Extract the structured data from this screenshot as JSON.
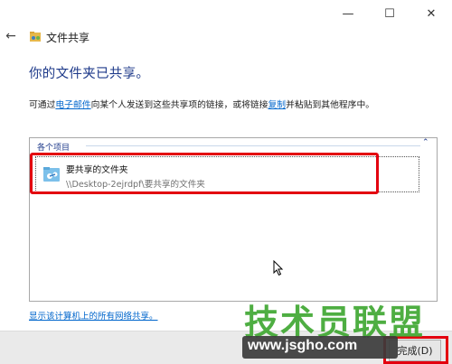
{
  "window": {
    "title": "文件共享",
    "minimize_glyph": "—",
    "maximize_glyph": "☐",
    "close_glyph": "✕"
  },
  "nav": {
    "back_glyph": "←"
  },
  "content": {
    "heading": "你的文件夹已共享。",
    "desc_prefix": "可通过",
    "desc_email_link": "电子邮件",
    "desc_middle": "向某个人发送到这些共享项的链接，或将链接",
    "desc_copy_link": "复制",
    "desc_suffix": "并粘贴到其他程序中。"
  },
  "list": {
    "group_label": "各个项目",
    "chevron_glyph": "⌃",
    "items": [
      {
        "name": "要共享的文件夹",
        "path": "\\\\Desktop-2ejrdpf\\要共享的文件夹"
      }
    ]
  },
  "footer": {
    "show_all_link": "显示该计算机上的所有网络共享。",
    "finish_label": "完成(D)"
  },
  "watermark": {
    "big_text": "技术员联盟",
    "small_text": "www.jsgho.com"
  },
  "colors": {
    "heading": "#1e3a8a",
    "link": "#0066cc",
    "highlight": "#e3000f",
    "watermark_green": "#40a832"
  },
  "icons": {
    "back": "back-arrow-icon",
    "title": "share-folder-icon",
    "folder": "shared-folder-icon",
    "cursor": "mouse-cursor-icon"
  }
}
